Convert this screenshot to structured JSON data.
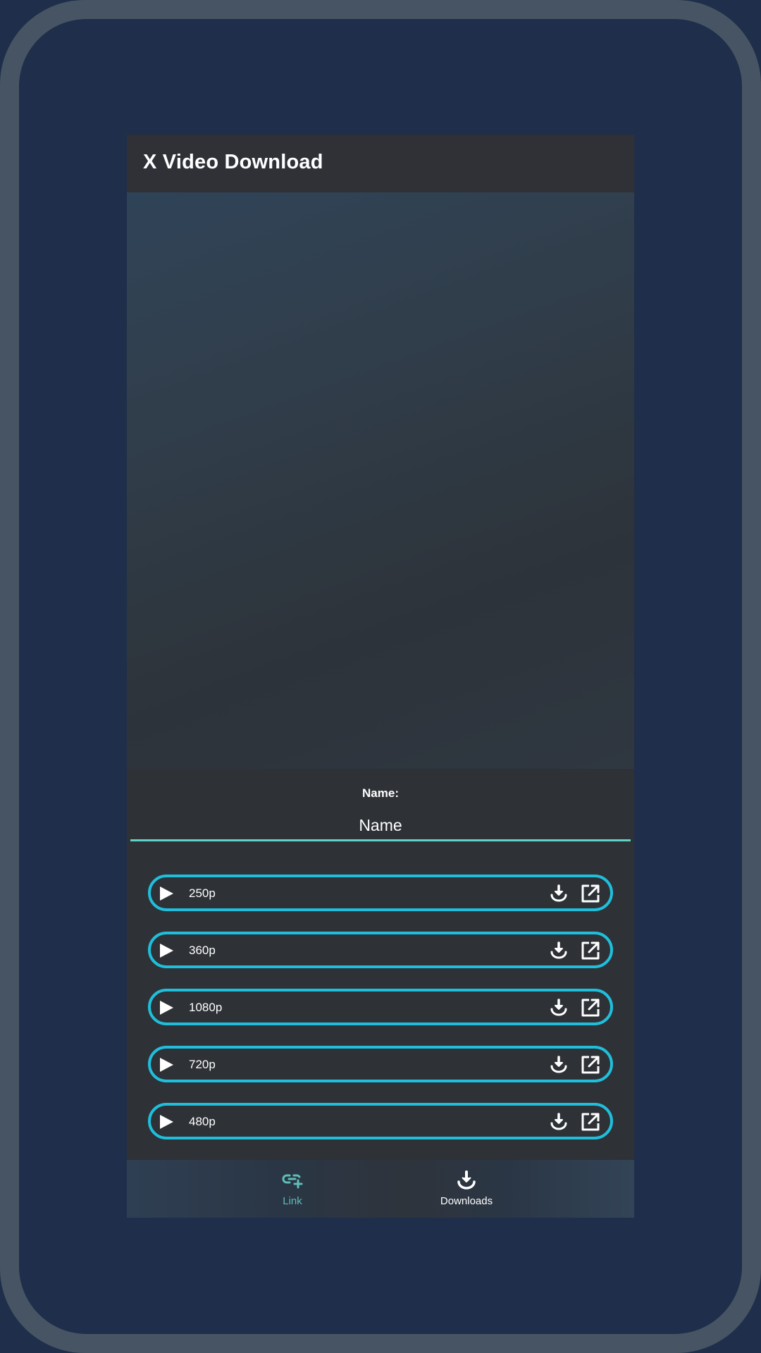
{
  "app": {
    "title": "X Video Download"
  },
  "name_field": {
    "label": "Name:",
    "value": "Name",
    "placeholder": "Name"
  },
  "qualities": [
    {
      "label": "250p"
    },
    {
      "label": "360p"
    },
    {
      "label": "1080p"
    },
    {
      "label": "720p"
    },
    {
      "label": "480p"
    }
  ],
  "bottom_nav": {
    "items": [
      {
        "label": "Link",
        "icon": "link-add-icon",
        "active": true
      },
      {
        "label": "Downloads",
        "icon": "download-icon",
        "active": false
      }
    ]
  },
  "colors": {
    "accent": "#1fbfdc",
    "input_underline": "#5fd3c8",
    "nav_active": "#5fbdb8",
    "surface": "#2e3136",
    "background": "#1f2e4a"
  }
}
